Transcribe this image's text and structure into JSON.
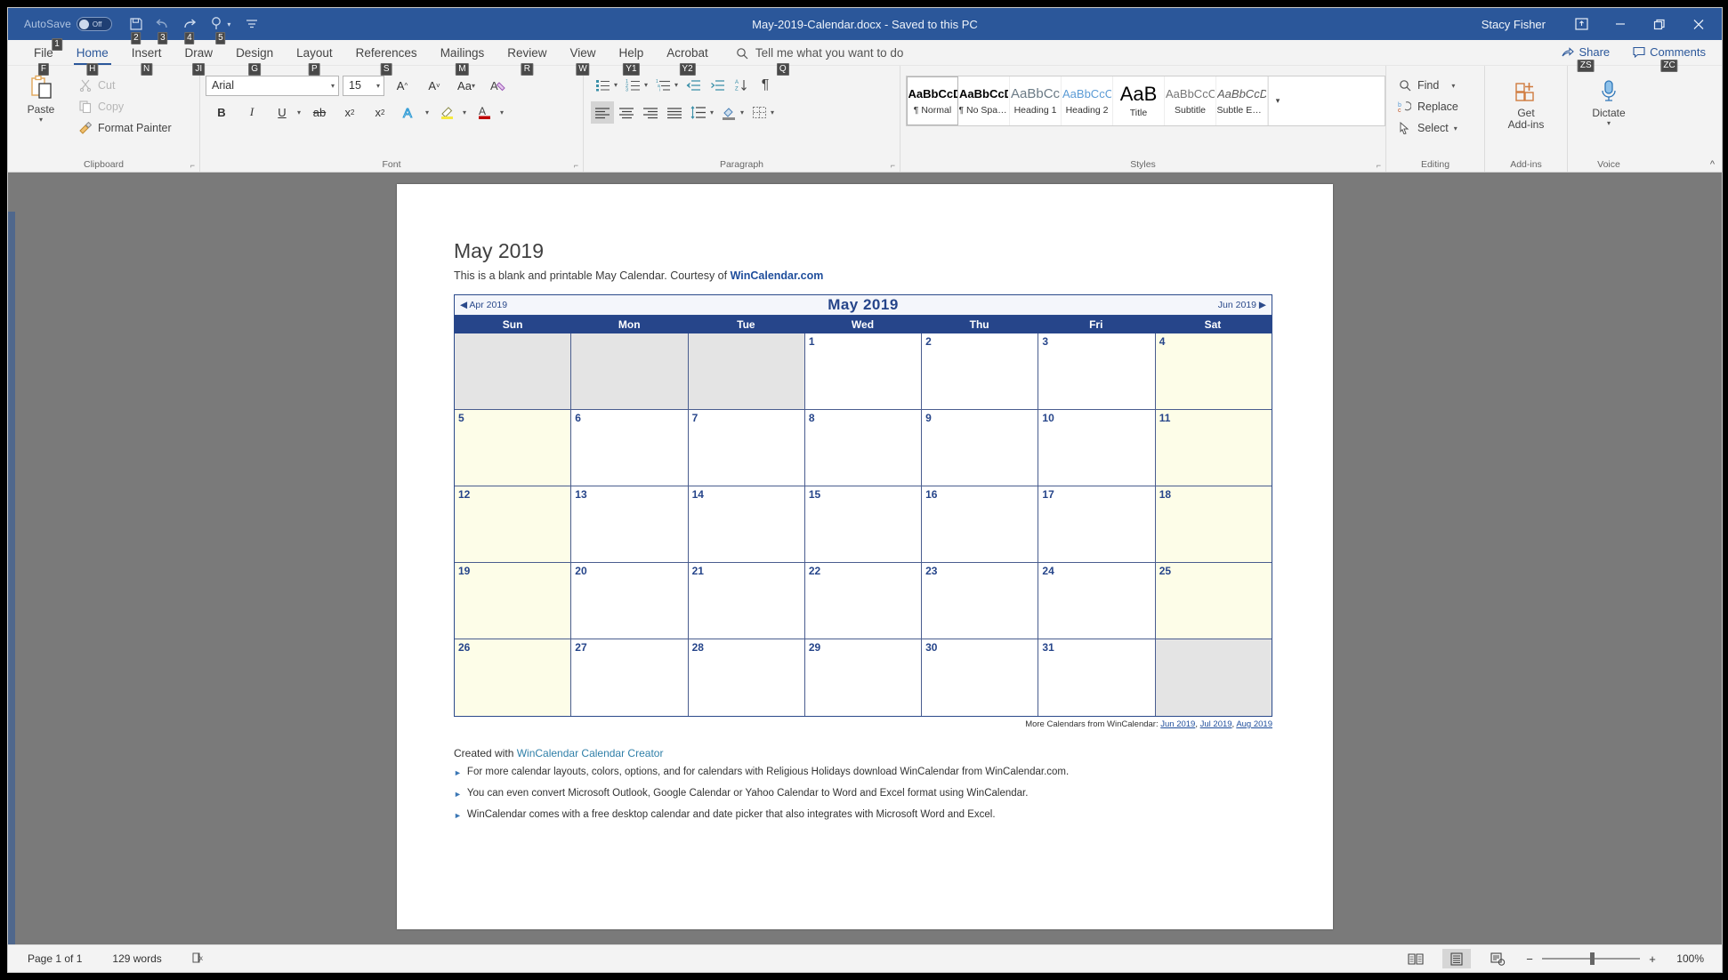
{
  "titlebar": {
    "autosave_label": "AutoSave",
    "autosave_state": "Off",
    "doc_title": "May-2019-Calendar.docx  -  Saved to this PC",
    "user": "Stacy Fisher",
    "qat": [
      {
        "name": "save-icon",
        "keytip": "1"
      },
      {
        "name": "undo-icon",
        "keytip": "2"
      },
      {
        "name": "redo-icon",
        "keytip": "3"
      },
      {
        "name": "touch-mode-icon",
        "keytip": "4"
      },
      {
        "name": "customize-qat-icon",
        "keytip": "5"
      }
    ],
    "window_buttons": [
      "ribbon-display-options",
      "minimize",
      "restore",
      "close"
    ]
  },
  "tabs": [
    {
      "label": "File",
      "keytip": "F",
      "active": false
    },
    {
      "label": "Home",
      "keytip": "H",
      "active": true
    },
    {
      "label": "Insert",
      "keytip": "N",
      "active": false
    },
    {
      "label": "Draw",
      "keytip": "JI",
      "active": false
    },
    {
      "label": "Design",
      "keytip": "G",
      "active": false
    },
    {
      "label": "Layout",
      "keytip": "P",
      "active": false
    },
    {
      "label": "References",
      "keytip": "S",
      "active": false
    },
    {
      "label": "Mailings",
      "keytip": "M",
      "active": false
    },
    {
      "label": "Review",
      "keytip": "R",
      "active": false
    },
    {
      "label": "View",
      "keytip": "W",
      "active": false
    },
    {
      "label": "Help",
      "keytip": "Y1",
      "active": false
    },
    {
      "label": "Acrobat",
      "keytip": "Y2",
      "active": false
    }
  ],
  "tellme": {
    "placeholder": "Tell me what you want to do",
    "keytip": "Q"
  },
  "share": {
    "label": "Share",
    "keytip": "ZS"
  },
  "comments": {
    "label": "Comments",
    "keytip": "ZC"
  },
  "ribbon": {
    "clipboard": {
      "group_label": "Clipboard",
      "paste": "Paste",
      "cut": "Cut",
      "copy": "Copy",
      "format_painter": "Format Painter"
    },
    "font": {
      "group_label": "Font",
      "font_family": "Arial",
      "font_size": "15",
      "grow_font": "A",
      "shrink_font": "A",
      "change_case": "Aa",
      "clear_formatting": "A",
      "bold": "B",
      "italic": "I",
      "underline": "U",
      "strikethrough": "ab",
      "subscript": "x",
      "superscript": "x",
      "text_effects": "A",
      "highlight": "A",
      "font_color": "A"
    },
    "paragraph": {
      "group_label": "Paragraph"
    },
    "styles": {
      "group_label": "Styles",
      "items": [
        {
          "preview": "AaBbCcDc",
          "name": "¶ Normal",
          "selected": true
        },
        {
          "preview": "AaBbCcDc",
          "name": "¶ No Spac...",
          "selected": false
        },
        {
          "preview": "AaBbCc",
          "name": "Heading 1",
          "selected": false
        },
        {
          "preview": "AaBbCcC",
          "name": "Heading 2",
          "selected": false
        },
        {
          "preview": "AaB",
          "name": "Title",
          "selected": false
        },
        {
          "preview": "AaBbCcC",
          "name": "Subtitle",
          "selected": false
        },
        {
          "preview": "AaBbCcDc",
          "name": "Subtle Em...",
          "selected": false
        }
      ]
    },
    "editing": {
      "group_label": "Editing",
      "find": "Find",
      "replace": "Replace",
      "select": "Select"
    },
    "addins": {
      "group_label": "Add-ins",
      "get_addins": "Get\nAdd-ins"
    },
    "voice": {
      "group_label": "Voice",
      "dictate": "Dictate"
    }
  },
  "document": {
    "heading": "May 2019",
    "subtitle_pre": "This is a blank and printable May Calendar.  Courtesy of ",
    "subtitle_link": "WinCalendar.com",
    "calendar": {
      "prev_month": "◀ Apr 2019",
      "month_title": "May  2019",
      "next_month": "Jun 2019 ▶",
      "day_headers": [
        "Sun",
        "Mon",
        "Tue",
        "Wed",
        "Thu",
        "Fri",
        "Sat"
      ],
      "weeks": [
        [
          null,
          null,
          null,
          "1",
          "2",
          "3",
          "4"
        ],
        [
          "5",
          "6",
          "7",
          "8",
          "9",
          "10",
          "11"
        ],
        [
          "12",
          "13",
          "14",
          "15",
          "16",
          "17",
          "18"
        ],
        [
          "19",
          "20",
          "21",
          "22",
          "23",
          "24",
          "25"
        ],
        [
          "26",
          "27",
          "28",
          "29",
          "30",
          "31",
          null
        ]
      ],
      "footer_label": "More Calendars from WinCalendar: ",
      "footer_links": [
        "Jun 2019",
        "Jul 2019",
        "Aug 2019"
      ]
    },
    "created_pre": "Created with ",
    "created_link": "WinCalendar Calendar Creator",
    "bullets": [
      "For more calendar layouts, colors, options, and for calendars with Religious Holidays download WinCalendar from WinCalendar.com.",
      "You can even convert Microsoft Outlook, Google Calendar or Yahoo Calendar to Word and Excel format using WinCalendar.",
      "WinCalendar comes with a free desktop calendar and date picker that also integrates with Microsoft Word and Excel."
    ]
  },
  "statusbar": {
    "page": "Page 1 of 1",
    "words": "129 words",
    "proofing_icon": "proofing-errors-icon",
    "views": [
      "read-mode",
      "print-layout",
      "web-layout"
    ],
    "zoom": "100%"
  },
  "colors": {
    "accent": "#2b579a",
    "calendar_header": "#26458a",
    "weekend_fill": "#fdfde8",
    "blank_fill": "#e4e4e4"
  }
}
